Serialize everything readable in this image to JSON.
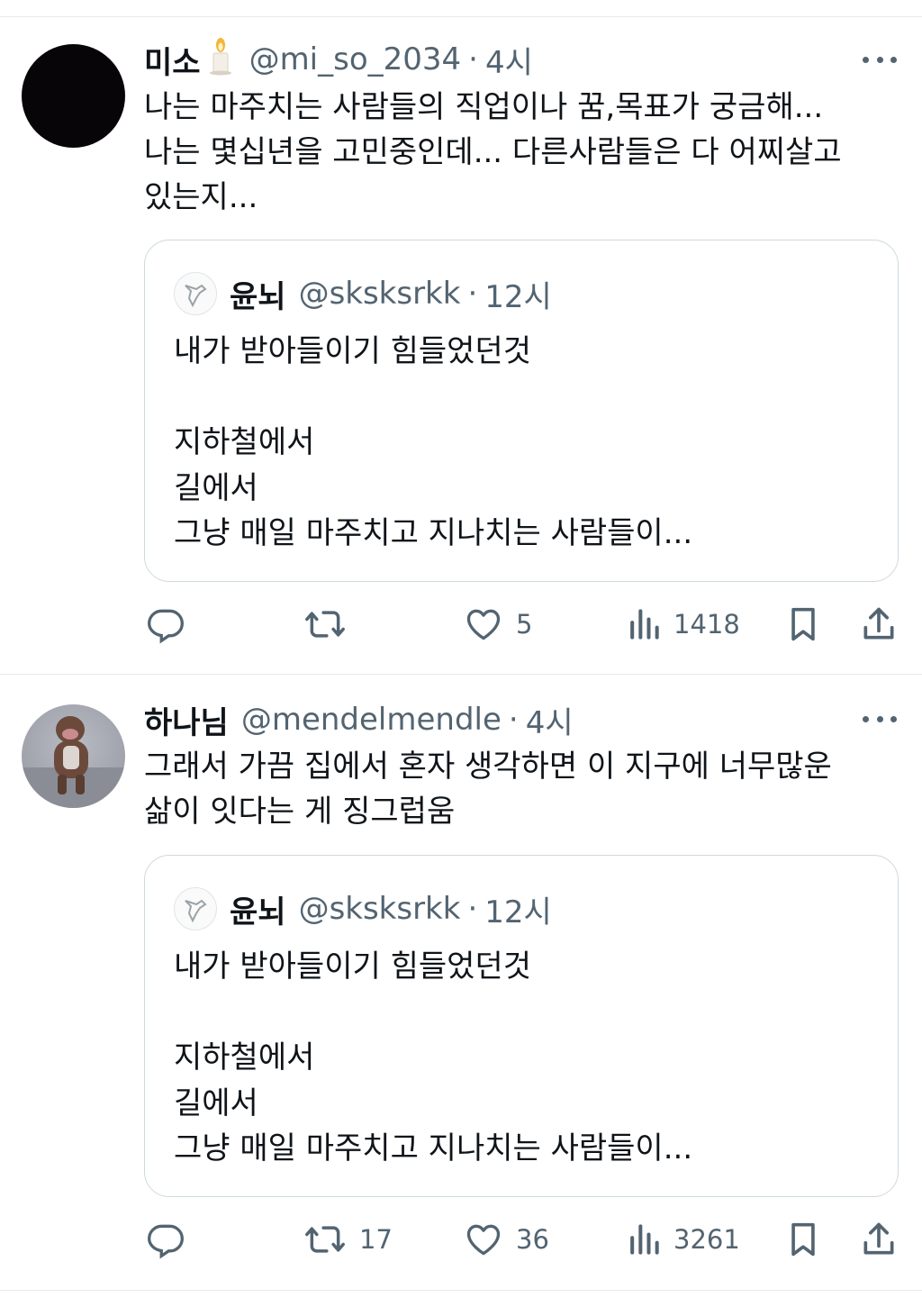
{
  "tweets": [
    {
      "name": "미소",
      "handle": "@mi_so_2034",
      "dot": "·",
      "time": "4시",
      "text": "나는 마주치는 사람들의 직업이나 꿈,목표가 궁금해...\n나는 몇십년을 고민중인데... 다른사람들은 다 어찌살고\n있는지...",
      "quote": {
        "name": "윤뇌",
        "handle": "@sksksrkk",
        "dot": "·",
        "time": "12시",
        "text": "내가 받아들이기 힘들었던것\n\n지하철에서\n길에서\n그냥 매일 마주치고 지나치는 사람들이..."
      },
      "counts": {
        "reply": "",
        "retweet": "",
        "like": "5",
        "views": "1418"
      },
      "icons": [
        "reply-icon",
        "retweet-icon",
        "heart-icon",
        "views-icon",
        "bookmark-icon",
        "share-icon"
      ]
    },
    {
      "name": "하나님",
      "handle": "@mendelmendle",
      "dot": "·",
      "time": "4시",
      "text": "그래서 가끔 집에서 혼자 생각하면 이 지구에 너무많운\n삶이 잇다는 게 징그럽움",
      "quote": {
        "name": "윤뇌",
        "handle": "@sksksrkk",
        "dot": "·",
        "time": "12시",
        "text": "내가 받아들이기 힘들었던것\n\n지하철에서\n길에서\n그냥 매일 마주치고 지나치는 사람들이..."
      },
      "counts": {
        "reply": "",
        "retweet": "17",
        "like": "36",
        "views": "3261"
      },
      "icons": [
        "reply-icon",
        "retweet-icon",
        "heart-icon",
        "views-icon",
        "bookmark-icon",
        "share-icon"
      ]
    }
  ],
  "colors": {
    "text": "#0f1419",
    "secondary": "#536471",
    "border": "#cfd9de",
    "divider": "#e7e9ea"
  }
}
